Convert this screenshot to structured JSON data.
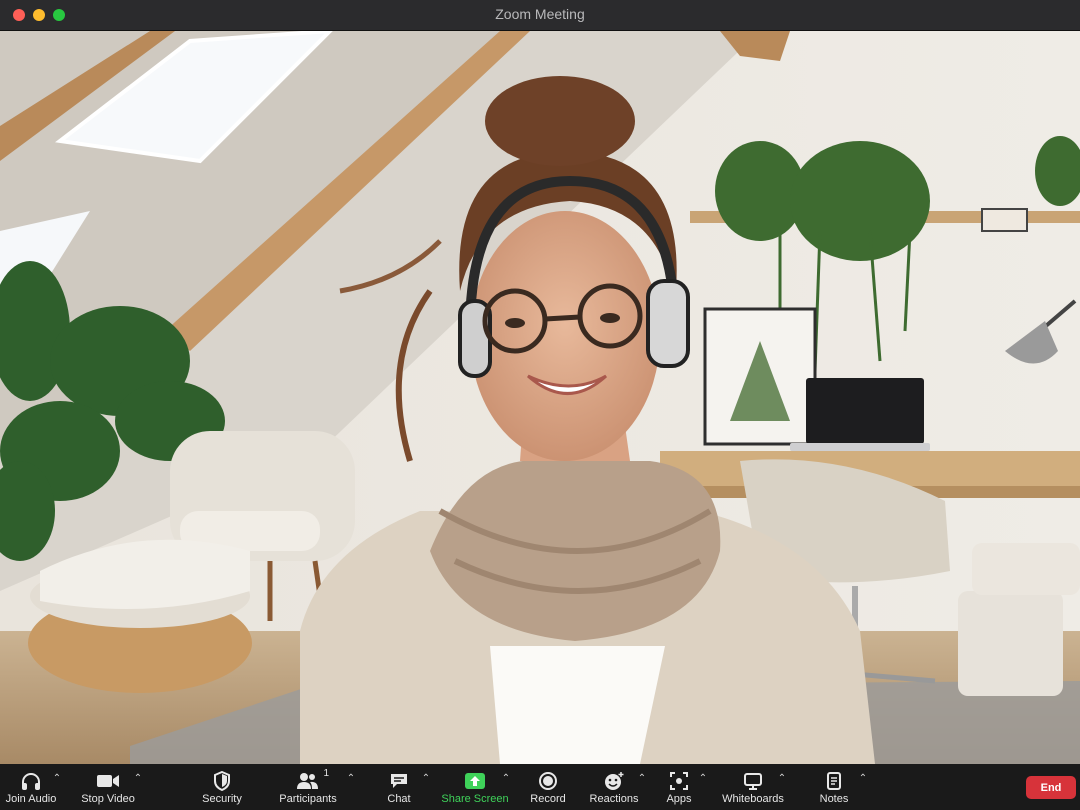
{
  "window": {
    "title": "Zoom Meeting"
  },
  "toolbar": {
    "join_audio": "Join Audio",
    "stop_video": "Stop Video",
    "security": "Security",
    "participants": "Participants",
    "participants_count": "1",
    "chat": "Chat",
    "share_screen": "Share Screen",
    "record": "Record",
    "reactions": "Reactions",
    "apps": "Apps",
    "whiteboards": "Whiteboards",
    "notes": "Notes",
    "end": "End"
  },
  "colors": {
    "share_screen_accent": "#3fd25a",
    "end_button": "#d7333a",
    "toolbar_bg": "#1a1a1a",
    "titlebar_bg": "#2b2b2d"
  },
  "icons": {
    "join_audio": "headphones-icon",
    "stop_video": "video-camera-icon",
    "security": "shield-icon",
    "participants": "people-icon",
    "chat": "chat-bubble-icon",
    "share_screen": "share-arrow-icon",
    "record": "record-icon",
    "reactions": "smiley-icon",
    "apps": "apps-icon",
    "whiteboards": "whiteboard-icon",
    "notes": "notes-icon"
  }
}
